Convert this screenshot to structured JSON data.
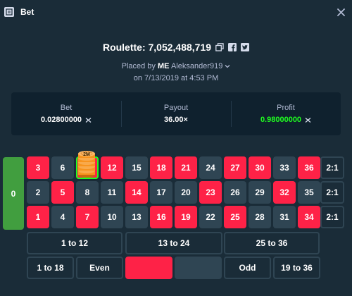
{
  "header": {
    "title": "Bet",
    "icon": "bet-slip-icon",
    "close_icon": "close-icon"
  },
  "bet": {
    "game_title": "Roulette: 7,052,488,719",
    "placed_by_prefix": "Placed by",
    "user_rank": "ME",
    "username": "Aleksander919",
    "date": "on 7/13/2019 at 4:53 PM"
  },
  "stats": {
    "bet_label": "Bet",
    "bet_value": "0.02800000",
    "payout_label": "Payout",
    "payout_value": "36.00×",
    "profit_label": "Profit",
    "profit_value": "0.98000000",
    "currency_icon": "xrp-coin-icon"
  },
  "board": {
    "zero": "0",
    "column_bet": "2:1",
    "rows": [
      [
        "3",
        "6",
        "9",
        "12",
        "15",
        "18",
        "21",
        "24",
        "27",
        "30",
        "33",
        "36"
      ],
      [
        "2",
        "5",
        "8",
        "11",
        "14",
        "17",
        "20",
        "23",
        "26",
        "29",
        "32",
        "35"
      ],
      [
        "1",
        "4",
        "7",
        "10",
        "13",
        "16",
        "19",
        "22",
        "25",
        "28",
        "31",
        "34"
      ]
    ],
    "dozens": [
      "1 to 12",
      "13 to 24",
      "25 to 36"
    ],
    "outside": {
      "low": "1 to 18",
      "even": "Even",
      "red": "",
      "black": "",
      "odd": "Odd",
      "high": "19 to 36"
    },
    "chip_label": "2M",
    "selected_number": "9"
  },
  "colors": {
    "background": "#1a2c38",
    "red": "#fe2247",
    "black": "#2f4553",
    "green": "#419e3f",
    "profit": "#1fff20",
    "chip": "#f7931e"
  }
}
